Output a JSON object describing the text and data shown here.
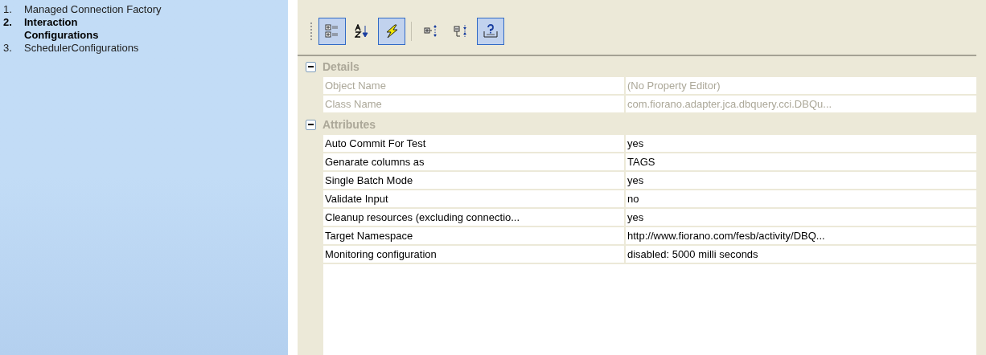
{
  "steps": [
    {
      "number": "1.",
      "label": "Managed Connection Factory",
      "selected": false
    },
    {
      "number": "2.",
      "label": "Interaction Configurations",
      "selected": true
    },
    {
      "number": "3.",
      "label": "SchedulerConfigurations",
      "selected": false
    }
  ],
  "toolbar": [
    {
      "kind": "categorized",
      "pressed": true
    },
    {
      "kind": "alphabetical",
      "pressed": false
    },
    {
      "kind": "events",
      "pressed": true
    },
    {
      "kind": "separator",
      "pressed": false
    },
    {
      "kind": "expand",
      "pressed": false
    },
    {
      "kind": "collapse",
      "pressed": false
    },
    {
      "kind": "help",
      "pressed": true
    }
  ],
  "sections": [
    {
      "title": "Details",
      "expanded": true,
      "rows": [
        {
          "name": "Object Name",
          "value": "(No Property Editor)",
          "disabled": true
        },
        {
          "name": "Class Name",
          "value": "com.fiorano.adapter.jca.dbquery.cci.DBQu...",
          "disabled": true
        }
      ]
    },
    {
      "title": "Attributes",
      "expanded": true,
      "rows": [
        {
          "name": "Auto Commit For Test",
          "value": "yes",
          "disabled": false
        },
        {
          "name": "Genarate columns as",
          "value": "TAGS",
          "disabled": false
        },
        {
          "name": "Single Batch Mode",
          "value": "yes",
          "disabled": false
        },
        {
          "name": "Validate Input",
          "value": "no",
          "disabled": false
        },
        {
          "name": "Cleanup resources (excluding connectio...",
          "value": "yes",
          "disabled": false
        },
        {
          "name": "Target Namespace",
          "value": "http://www.fiorano.com/fesb/activity/DBQ...",
          "disabled": false
        },
        {
          "name": "Monitoring configuration",
          "value": "disabled: 5000 milli seconds",
          "disabled": false
        }
      ]
    }
  ]
}
